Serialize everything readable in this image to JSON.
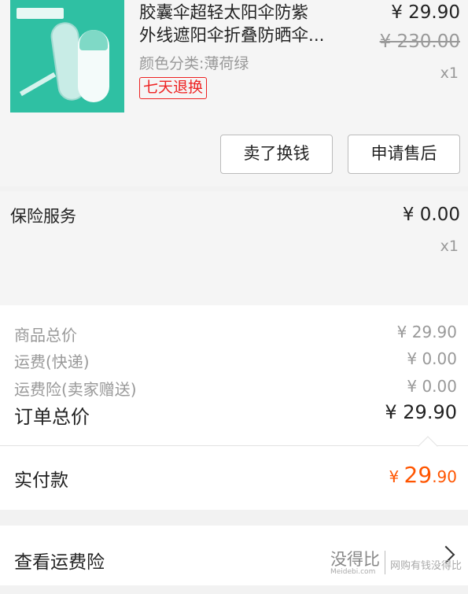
{
  "product": {
    "title": "胶囊伞超轻太阳伞防紫外线遮阳伞折叠防晒伞...",
    "title_line1": "胶囊伞超轻太阳伞防紫",
    "title_line2": "外线遮阳伞折叠防晒伞...",
    "spec": "颜色分类:薄荷绿",
    "badge": "七天退换",
    "price": "¥ 29.90",
    "original_price": "¥ 230.00",
    "quantity": "x1",
    "buttons": {
      "sell": "卖了换钱",
      "after_sales": "申请售后"
    }
  },
  "insurance": {
    "title": "保险服务",
    "price": "¥ 0.00",
    "quantity": "x1"
  },
  "summary": {
    "rows": [
      {
        "label": "商品总价",
        "value": "¥ 29.90"
      },
      {
        "label": "运费(快递)",
        "value": "¥ 0.00"
      },
      {
        "label": "运费险(卖家赠送)",
        "value": "¥ 0.00"
      }
    ],
    "total_label": "订单总价",
    "total_value": "¥ 29.90"
  },
  "paid": {
    "label": "实付款",
    "currency": "¥ ",
    "integer": "29",
    "decimal": ".90",
    "color": "#ff5500"
  },
  "shipping_insurance_link": {
    "label": "查看运费险",
    "icon": "chevron-right-icon"
  },
  "watermark": {
    "name": "没得比",
    "url": "Meidebi.com",
    "slogan": "网购有钱没得比"
  }
}
